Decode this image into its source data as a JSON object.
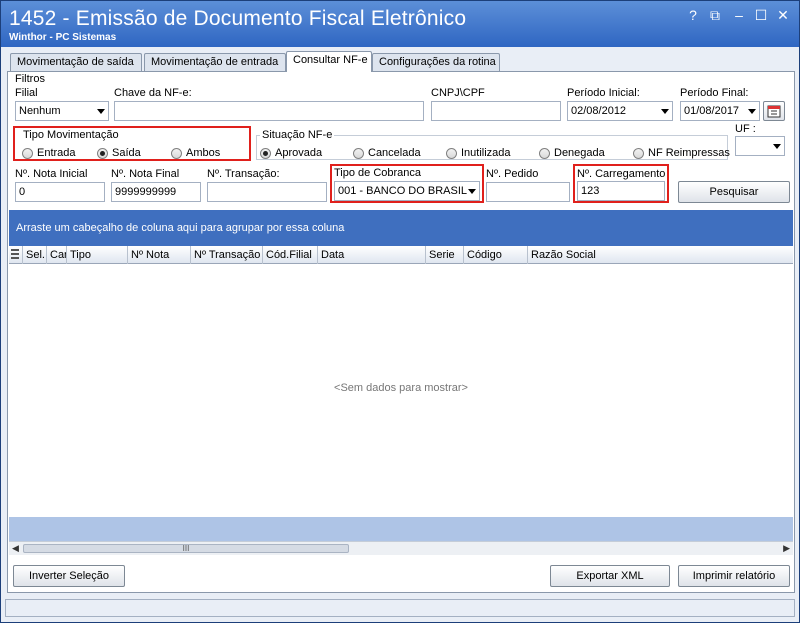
{
  "window": {
    "title": "1452 - Emissão de Documento Fiscal Eletrônico",
    "subtitle": "Winthor - PC Sistemas",
    "controls": {
      "help": "?",
      "restore": "⧉",
      "minimize": "–",
      "maximize": "☐",
      "close": "✕"
    }
  },
  "tabs": [
    {
      "label": "Movimentação de saída"
    },
    {
      "label": "Movimentação de entrada"
    },
    {
      "label": "Consultar NF-e"
    },
    {
      "label": "Configurações da rotina"
    }
  ],
  "filters": {
    "group_label": "Filtros",
    "filial": {
      "label": "Filial",
      "value": "Nenhum"
    },
    "chave": {
      "label": "Chave da NF-e:",
      "value": ""
    },
    "cnpj": {
      "label": "CNPJ\\CPF",
      "value": ""
    },
    "periodo_inicial": {
      "label": "Período Inicial:",
      "value": "02/08/2012"
    },
    "periodo_final": {
      "label": "Período Final:",
      "value": "01/08/2017"
    },
    "uf": {
      "label": "UF :",
      "value": ""
    },
    "tipo_movimentacao": {
      "label": "Tipo Movimentação",
      "options": [
        {
          "label": "Entrada",
          "checked": false
        },
        {
          "label": "Saída",
          "checked": true
        },
        {
          "label": "Ambos",
          "checked": false
        }
      ]
    },
    "situacao": {
      "label": "Situação NF-e",
      "options": [
        {
          "label": "Aprovada",
          "checked": true
        },
        {
          "label": "Cancelada",
          "checked": false
        },
        {
          "label": "Inutilizada",
          "checked": false
        },
        {
          "label": "Denegada",
          "checked": false
        },
        {
          "label": "NF Reimpressas",
          "checked": false
        }
      ]
    },
    "nota_inicial": {
      "label": "Nº. Nota Inicial",
      "value": "0"
    },
    "nota_final": {
      "label": "Nº. Nota Final",
      "value": "9999999999"
    },
    "transacao": {
      "label": "Nº. Transação:",
      "value": ""
    },
    "tipo_cobranca": {
      "label": "Tipo de Cobranca",
      "value": "001 - BANCO DO BRASIL -"
    },
    "pedido": {
      "label": "Nº. Pedido",
      "value": ""
    },
    "carregamento": {
      "label": "Nº. Carregamento",
      "value": "123"
    },
    "pesquisar_label": "Pesquisar"
  },
  "grid": {
    "group_hint": "Arraste um cabeçalho de coluna aqui para agrupar por essa coluna",
    "columns": [
      "Sel.",
      "Car",
      "Tipo",
      "Nº Nota",
      "Nº Transação",
      "Cód.Filial",
      "Data",
      "Serie",
      "Código",
      "Razão Social"
    ],
    "empty_text": "<Sem dados para mostrar>",
    "scroll_grip": "III"
  },
  "buttons": {
    "inverter": "Inverter Seleção",
    "exportar": "Exportar XML",
    "imprimir": "Imprimir relatório"
  },
  "colors": {
    "accent": "#3f6fbf",
    "highlight": "#e0201c"
  }
}
